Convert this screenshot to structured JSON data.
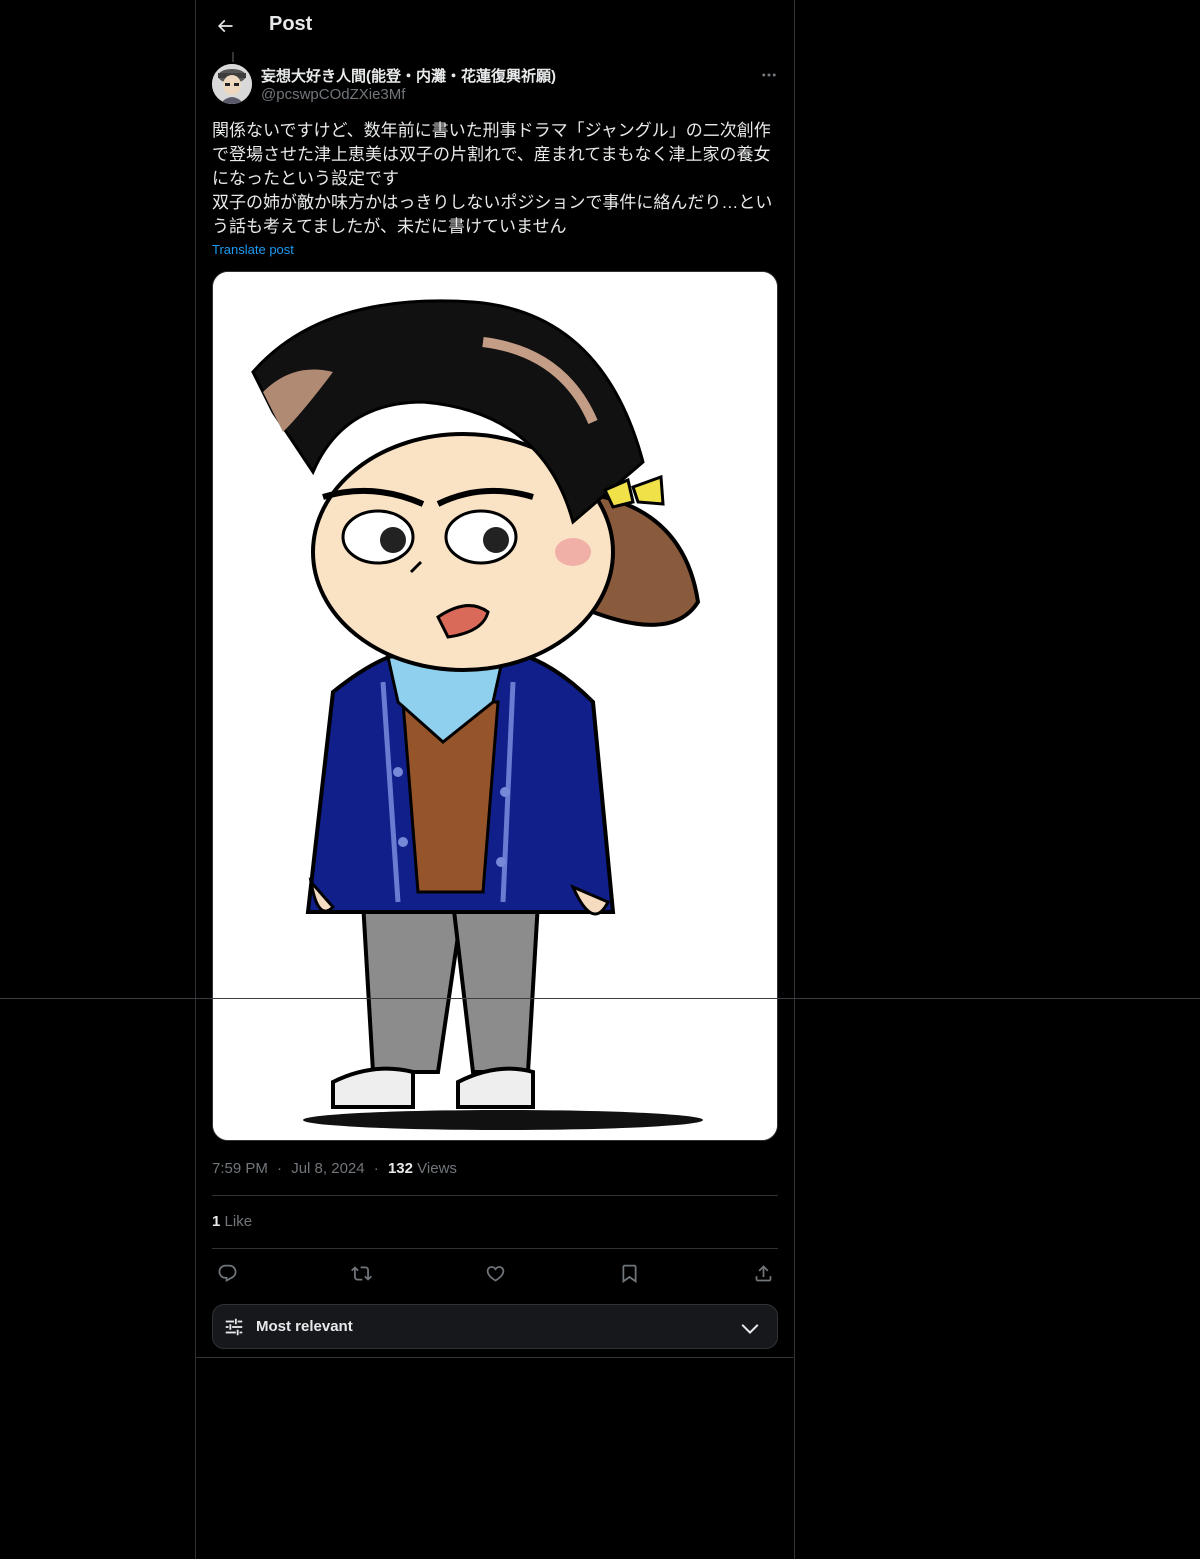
{
  "header": {
    "title": "Post",
    "back_icon": "arrow-left-icon"
  },
  "author": {
    "display_name": "妄想大好き人間(能登・内灘・花蓮復興祈願)",
    "handle": "@pcswpCOdZXie3Mf",
    "avatar_icon": "avatar-illustration"
  },
  "post": {
    "text_lines": [
      "関係ないですけど、数年前に書いた刑事ドラマ「ジャングル」の二次創作",
      "で登場させた津上恵美は双子の片割れで、産まれてまもなく津上家の養女",
      "になったという設定です",
      "双子の姉が敵か味方かはっきりしないポジションで事件に絡んだり…とい",
      "う話も考えてましたが、未だに書けていません"
    ],
    "translate_label": "Translate post",
    "media_description_icon": "illustration-image"
  },
  "meta": {
    "time": "7:59 PM",
    "separator": "·",
    "date": "Jul 8, 2024",
    "views_count": "132",
    "views_label": "Views"
  },
  "engagement": {
    "likes_count": "1",
    "likes_label": "Like"
  },
  "actions": [
    {
      "name": "reply-icon"
    },
    {
      "name": "repost-icon"
    },
    {
      "name": "like-icon"
    },
    {
      "name": "bookmark-icon"
    },
    {
      "name": "share-icon"
    }
  ],
  "sort": {
    "label": "Most relevant",
    "icon": "sliders-icon",
    "chevron": "chevron-down-icon"
  },
  "colors": {
    "background": "#000000",
    "text": "#e7e9ea",
    "secondary": "#71767b",
    "accent": "#1d9bf0",
    "border": "#2f3336"
  }
}
